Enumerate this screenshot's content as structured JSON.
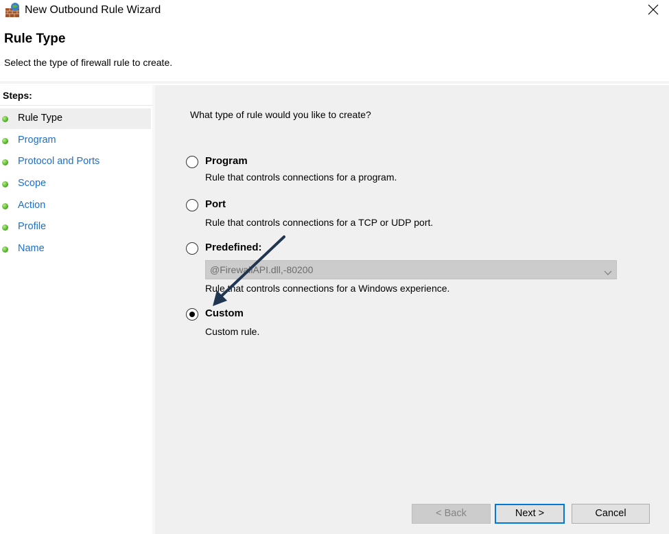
{
  "window": {
    "title": "New Outbound Rule Wizard",
    "app_icon": "firewall-icon",
    "close_icon": "close-icon"
  },
  "header": {
    "title": "Rule Type",
    "subtitle": "Select the type of firewall rule to create."
  },
  "steps": {
    "heading": "Steps:",
    "items": [
      {
        "label": "Rule Type",
        "current": true
      },
      {
        "label": "Program",
        "current": false
      },
      {
        "label": "Protocol and Ports",
        "current": false
      },
      {
        "label": "Scope",
        "current": false
      },
      {
        "label": "Action",
        "current": false
      },
      {
        "label": "Profile",
        "current": false
      },
      {
        "label": "Name",
        "current": false
      }
    ]
  },
  "main": {
    "question": "What type of rule would you like to create?",
    "options": [
      {
        "title": "Program",
        "description": "Rule that controls connections for a program.",
        "selected": false
      },
      {
        "title": "Port",
        "description": "Rule that controls connections for a TCP or UDP port.",
        "selected": false
      },
      {
        "title": "Predefined:",
        "description": "Rule that controls connections for a Windows experience.",
        "selected": false
      },
      {
        "title": "Custom",
        "description": "Custom rule.",
        "selected": true
      }
    ],
    "predefined_select": {
      "value": "@FirewallAPI.dll,-80200",
      "enabled": false
    }
  },
  "buttons": {
    "back": "< Back",
    "next": "Next >",
    "cancel": "Cancel"
  },
  "colors": {
    "link": "#1a6fd0",
    "panel_bg": "#f0f0f0",
    "focus_border": "#0078d7",
    "annotation_arrow": "#1f3550"
  }
}
